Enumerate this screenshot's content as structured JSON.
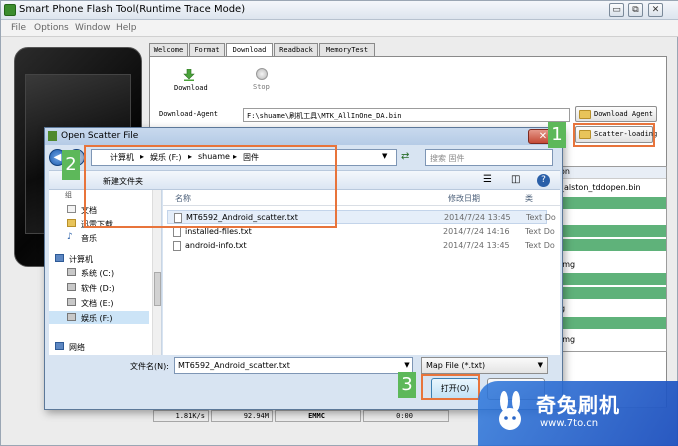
{
  "app": {
    "title": "Smart Phone Flash Tool(Runtime Trace Mode)",
    "window_controls": {
      "minimize": "▭",
      "restore": "⧉",
      "close": "✕"
    }
  },
  "menu": [
    "File",
    "Options",
    "Window",
    "Help"
  ],
  "tabs": [
    "Welcome",
    "Format",
    "Download",
    "Readback",
    "MemoryTest"
  ],
  "toolbar": {
    "download_label": "Download",
    "stop_label": "Stop"
  },
  "download_agent": {
    "label": "Download-Agent",
    "value": "F:\\shuame\\刷机工具\\MTK_AllInOne_DA.bin",
    "button": "Download Agent"
  },
  "scatter": {
    "label": "Scatter-loading File",
    "button": "Scatter-loading"
  },
  "bg_list": {
    "header": "on",
    "rows": [
      "_alston_tddopen.bin",
      "",
      "",
      "",
      "",
      "img",
      "",
      "",
      "",
      "g",
      "",
      "img",
      "",
      "",
      ""
    ]
  },
  "status": {
    "speed": "1.81K/s",
    "size": "92.94M",
    "storage": "EMMC",
    "time": "0:00"
  },
  "dialog": {
    "title": "Open Scatter File",
    "breadcrumbs": [
      "计算机",
      "娱乐 (F:)",
      "shuame",
      "固件"
    ],
    "search_placeholder": "搜索 固件",
    "new_folder": "新建文件夹",
    "nav_items": [
      {
        "label": "文档",
        "icon": "document-icon"
      },
      {
        "label": "迅雷下载",
        "icon": "folder-icon"
      },
      {
        "label": "音乐",
        "icon": "music-icon"
      },
      {
        "label": "计算机",
        "icon": "computer-icon"
      },
      {
        "label": "系统 (C:)",
        "icon": "drive-icon"
      },
      {
        "label": "软件 (D:)",
        "icon": "drive-icon"
      },
      {
        "label": "文档 (E:)",
        "icon": "drive-icon"
      },
      {
        "label": "娱乐 (F:)",
        "icon": "drive-icon"
      },
      {
        "label": "网络",
        "icon": "network-icon"
      }
    ],
    "nav_partial_top": "组",
    "columns": {
      "name": "名称",
      "date": "修改日期",
      "type": "类"
    },
    "files": [
      {
        "name": "MT6592_Android_scatter.txt",
        "date": "2014/7/24 13:45",
        "type": "Text Do"
      },
      {
        "name": "installed-files.txt",
        "date": "2014/7/24 14:16",
        "type": "Text Do"
      },
      {
        "name": "android-info.txt",
        "date": "2014/7/24 13:45",
        "type": "Text Do"
      }
    ],
    "filename_label": "文件名(N):",
    "filename_value": "MT6592_Android_scatter.txt",
    "filetype": "Map File (*.txt)",
    "open_button": "打开(O)",
    "cancel_button": ""
  },
  "annotations": {
    "step1": "1",
    "step2": "2",
    "step3": "3"
  },
  "watermark": {
    "text": "奇兔刷机",
    "url": "www.7to.cn"
  },
  "colors": {
    "annotation_orange": "#e8743b",
    "annotation_green": "#5db85a",
    "list_green": "#5fb27a"
  }
}
